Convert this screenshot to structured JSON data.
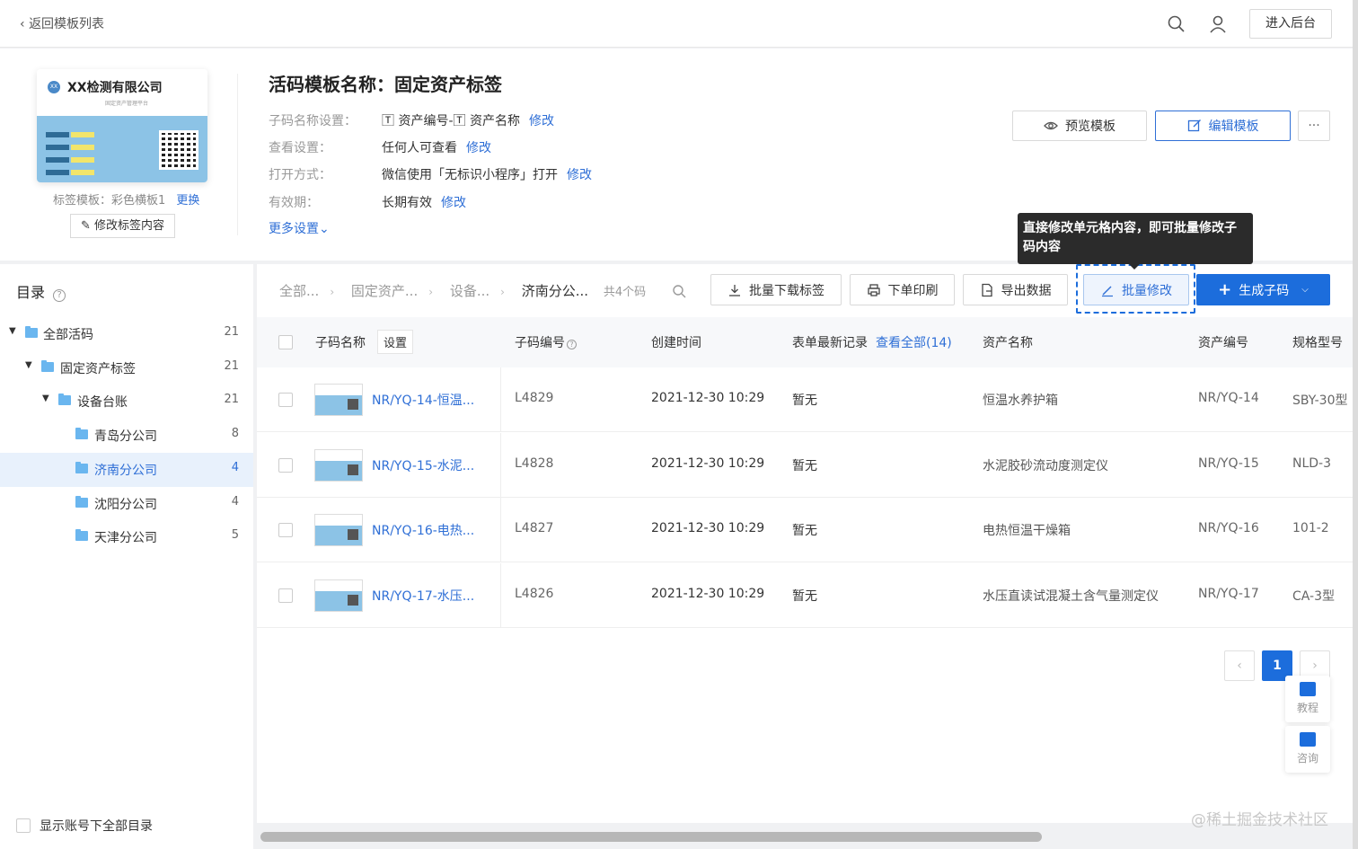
{
  "topbar": {
    "back_label": "返回模板列表",
    "admin_label": "进入后台",
    "icons": [
      "search-icon",
      "user-icon"
    ]
  },
  "label_preview": {
    "company": "XX检测有限公司",
    "subtitle": "固定资产管理平台",
    "logo_text": "XX",
    "template_prefix": "标签模板：彩色横板1",
    "replace_label": "更换",
    "edit_label_button": "修改标签内容"
  },
  "template": {
    "title": "活码模板名称：固定资产标签",
    "settings": [
      {
        "key": "子码名称设置：",
        "value": "🅃 资产编号-🅃 资产名称",
        "action": "修改"
      },
      {
        "key": "查看设置：",
        "value": "任何人可查看",
        "action": "修改"
      },
      {
        "key": "打开方式：",
        "value": "微信使用「无标识小程序」打开",
        "action": "修改"
      },
      {
        "key": "有效期：",
        "value": "长期有效",
        "action": "修改"
      }
    ],
    "more_settings": "更多设置⌄"
  },
  "header_actions": {
    "preview": "预览模板",
    "edit": "编辑模板",
    "more": "···"
  },
  "tooltip": "直接修改单元格内容，即可批量修改子码内容",
  "sidebar": {
    "title": "目录",
    "tree": [
      {
        "name": "全部活码",
        "count": "21"
      },
      {
        "name": "固定资产标签",
        "count": "21"
      },
      {
        "name": "设备台账",
        "count": "21"
      },
      {
        "name": "青岛分公司",
        "count": "8"
      },
      {
        "name": "济南分公司",
        "count": "4"
      },
      {
        "name": "沈阳分公司",
        "count": "4"
      },
      {
        "name": "天津分公司",
        "count": "5"
      }
    ],
    "show_all_label": "显示账号下全部目录"
  },
  "breadcrumb": {
    "items": [
      "全部...",
      "固定资产...",
      "设备...",
      "济南分公..."
    ],
    "count": "共4个码"
  },
  "toolbar": {
    "download": "批量下载标签",
    "print": "下单印刷",
    "export": "导出数据",
    "batch_edit": "批量修改",
    "generate": "生成子码"
  },
  "table": {
    "headers": {
      "name": "子码名称",
      "setting": "设置",
      "code": "子码编号",
      "created": "创建时间",
      "record": "表单最新记录",
      "view_all": "查看全部(14)",
      "asset_name": "资产名称",
      "asset_no": "资产编号",
      "model": "规格型号"
    },
    "rows": [
      {
        "name": "NR/YQ-14-恒温...",
        "code": "L4829",
        "created": "2021-12-30 10:29",
        "record": "暂无",
        "asset_name": "恒温水养护箱",
        "asset_no": "NR/YQ-14",
        "model": "SBY-30型"
      },
      {
        "name": "NR/YQ-15-水泥...",
        "code": "L4828",
        "created": "2021-12-30 10:29",
        "record": "暂无",
        "asset_name": "水泥胶砂流动度测定仪",
        "asset_no": "NR/YQ-15",
        "model": "NLD-3"
      },
      {
        "name": "NR/YQ-16-电热...",
        "code": "L4827",
        "created": "2021-12-30 10:29",
        "record": "暂无",
        "asset_name": "电热恒温干燥箱",
        "asset_no": "NR/YQ-16",
        "model": "101-2"
      },
      {
        "name": "NR/YQ-17-水压...",
        "code": "L4826",
        "created": "2021-12-30 10:29",
        "record": "暂无",
        "asset_name": "水压直读试混凝土含气量测定仪",
        "asset_no": "NR/YQ-17",
        "model": "CA-3型"
      }
    ]
  },
  "pagination": {
    "prev": "‹",
    "current": "1",
    "next": "›"
  },
  "float": {
    "tutorial": "教程",
    "consult": "咨询"
  },
  "watermark": "@稀土掘金技术社区",
  "colors": {
    "primary": "#1c6ddc",
    "link": "#2f6fd6",
    "folder": "#6ab6ef"
  }
}
